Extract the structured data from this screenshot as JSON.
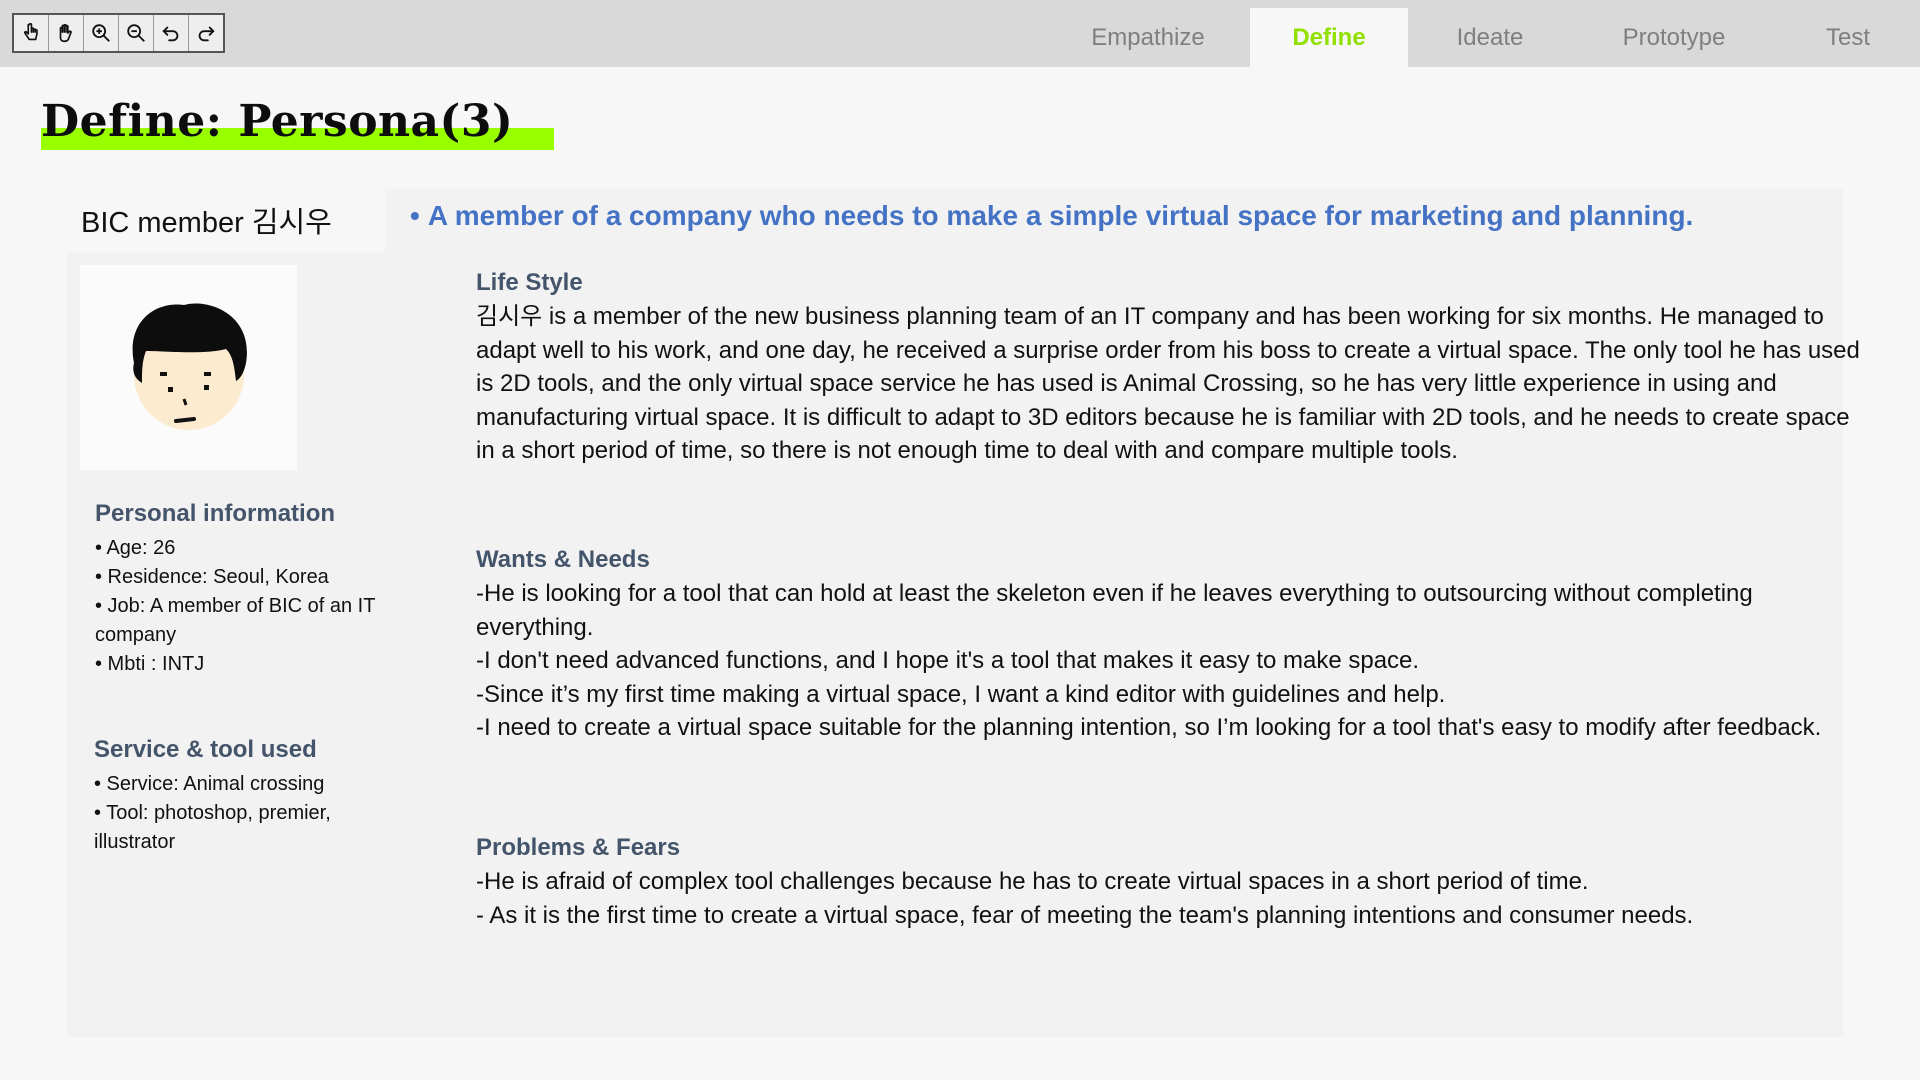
{
  "toolbar": {
    "tools": [
      {
        "name": "pointer-icon"
      },
      {
        "name": "hand-icon"
      },
      {
        "name": "zoom-in-icon"
      },
      {
        "name": "zoom-out-icon"
      },
      {
        "name": "undo-icon"
      },
      {
        "name": "redo-icon"
      }
    ]
  },
  "tabs": {
    "empathize": "Empathize",
    "define": "Define",
    "ideate": "Ideate",
    "prototype": "Prototype",
    "test": "Test",
    "active": "Define"
  },
  "colors": {
    "accent_green": "#99ff00",
    "active_tab_text": "#92e000",
    "summary_blue": "#4472c4",
    "heading_slate": "#44546a"
  },
  "page": {
    "title": "Define: Persona(3)"
  },
  "persona": {
    "name": "BIC member 김시우",
    "summary": "A member of a company who needs to make a simple virtual space for marketing and planning.",
    "summary_bullet": "•",
    "personal_info": {
      "heading": "Personal information",
      "items": [
        "• Age: 26",
        "• Residence: Seoul, Korea",
        "• Job: A member of BIC of an IT company",
        "• Mbti : INTJ"
      ]
    },
    "service_tool": {
      "heading": "Service & tool used",
      "items": [
        "• Service: Animal crossing",
        "• Tool: photoshop, premier, illustrator"
      ]
    },
    "life_style": {
      "heading": "Life Style",
      "text": "김시우 is a member of the new business planning team of an IT company and has been working for six months. He managed to adapt well to his work, and one day, he received a surprise order from his boss to create a virtual space. The only tool he has used is 2D tools, and the only virtual space service he has used is Animal Crossing, so he has very little experience in using and manufacturing virtual space. It is difficult to adapt to 3D editors because he is familiar with 2D tools, and he needs to create space in a short period of time, so there is not enough time to deal with and compare multiple tools."
    },
    "wants_needs": {
      "heading": "Wants & Needs",
      "items": [
        "-He is looking for a tool that can hold at least the skeleton even if he leaves everything to outsourcing without completing everything.",
        "-I don't need advanced functions, and I hope it's a tool that makes it easy to make space.",
        "-Since it’s my first time making a virtual space, I want a kind editor with guidelines and help.",
        "-I need to create a virtual space suitable for the planning intention, so I’m looking for a tool that's easy to modify after feedback."
      ]
    },
    "problems_fears": {
      "heading": "Problems & Fears",
      "items": [
        "-He is afraid of complex tool challenges because he has to create virtual spaces in a short period of time.",
        "- As it is the first time to create a virtual space, fear of meeting the team's planning intentions and consumer needs."
      ]
    }
  }
}
